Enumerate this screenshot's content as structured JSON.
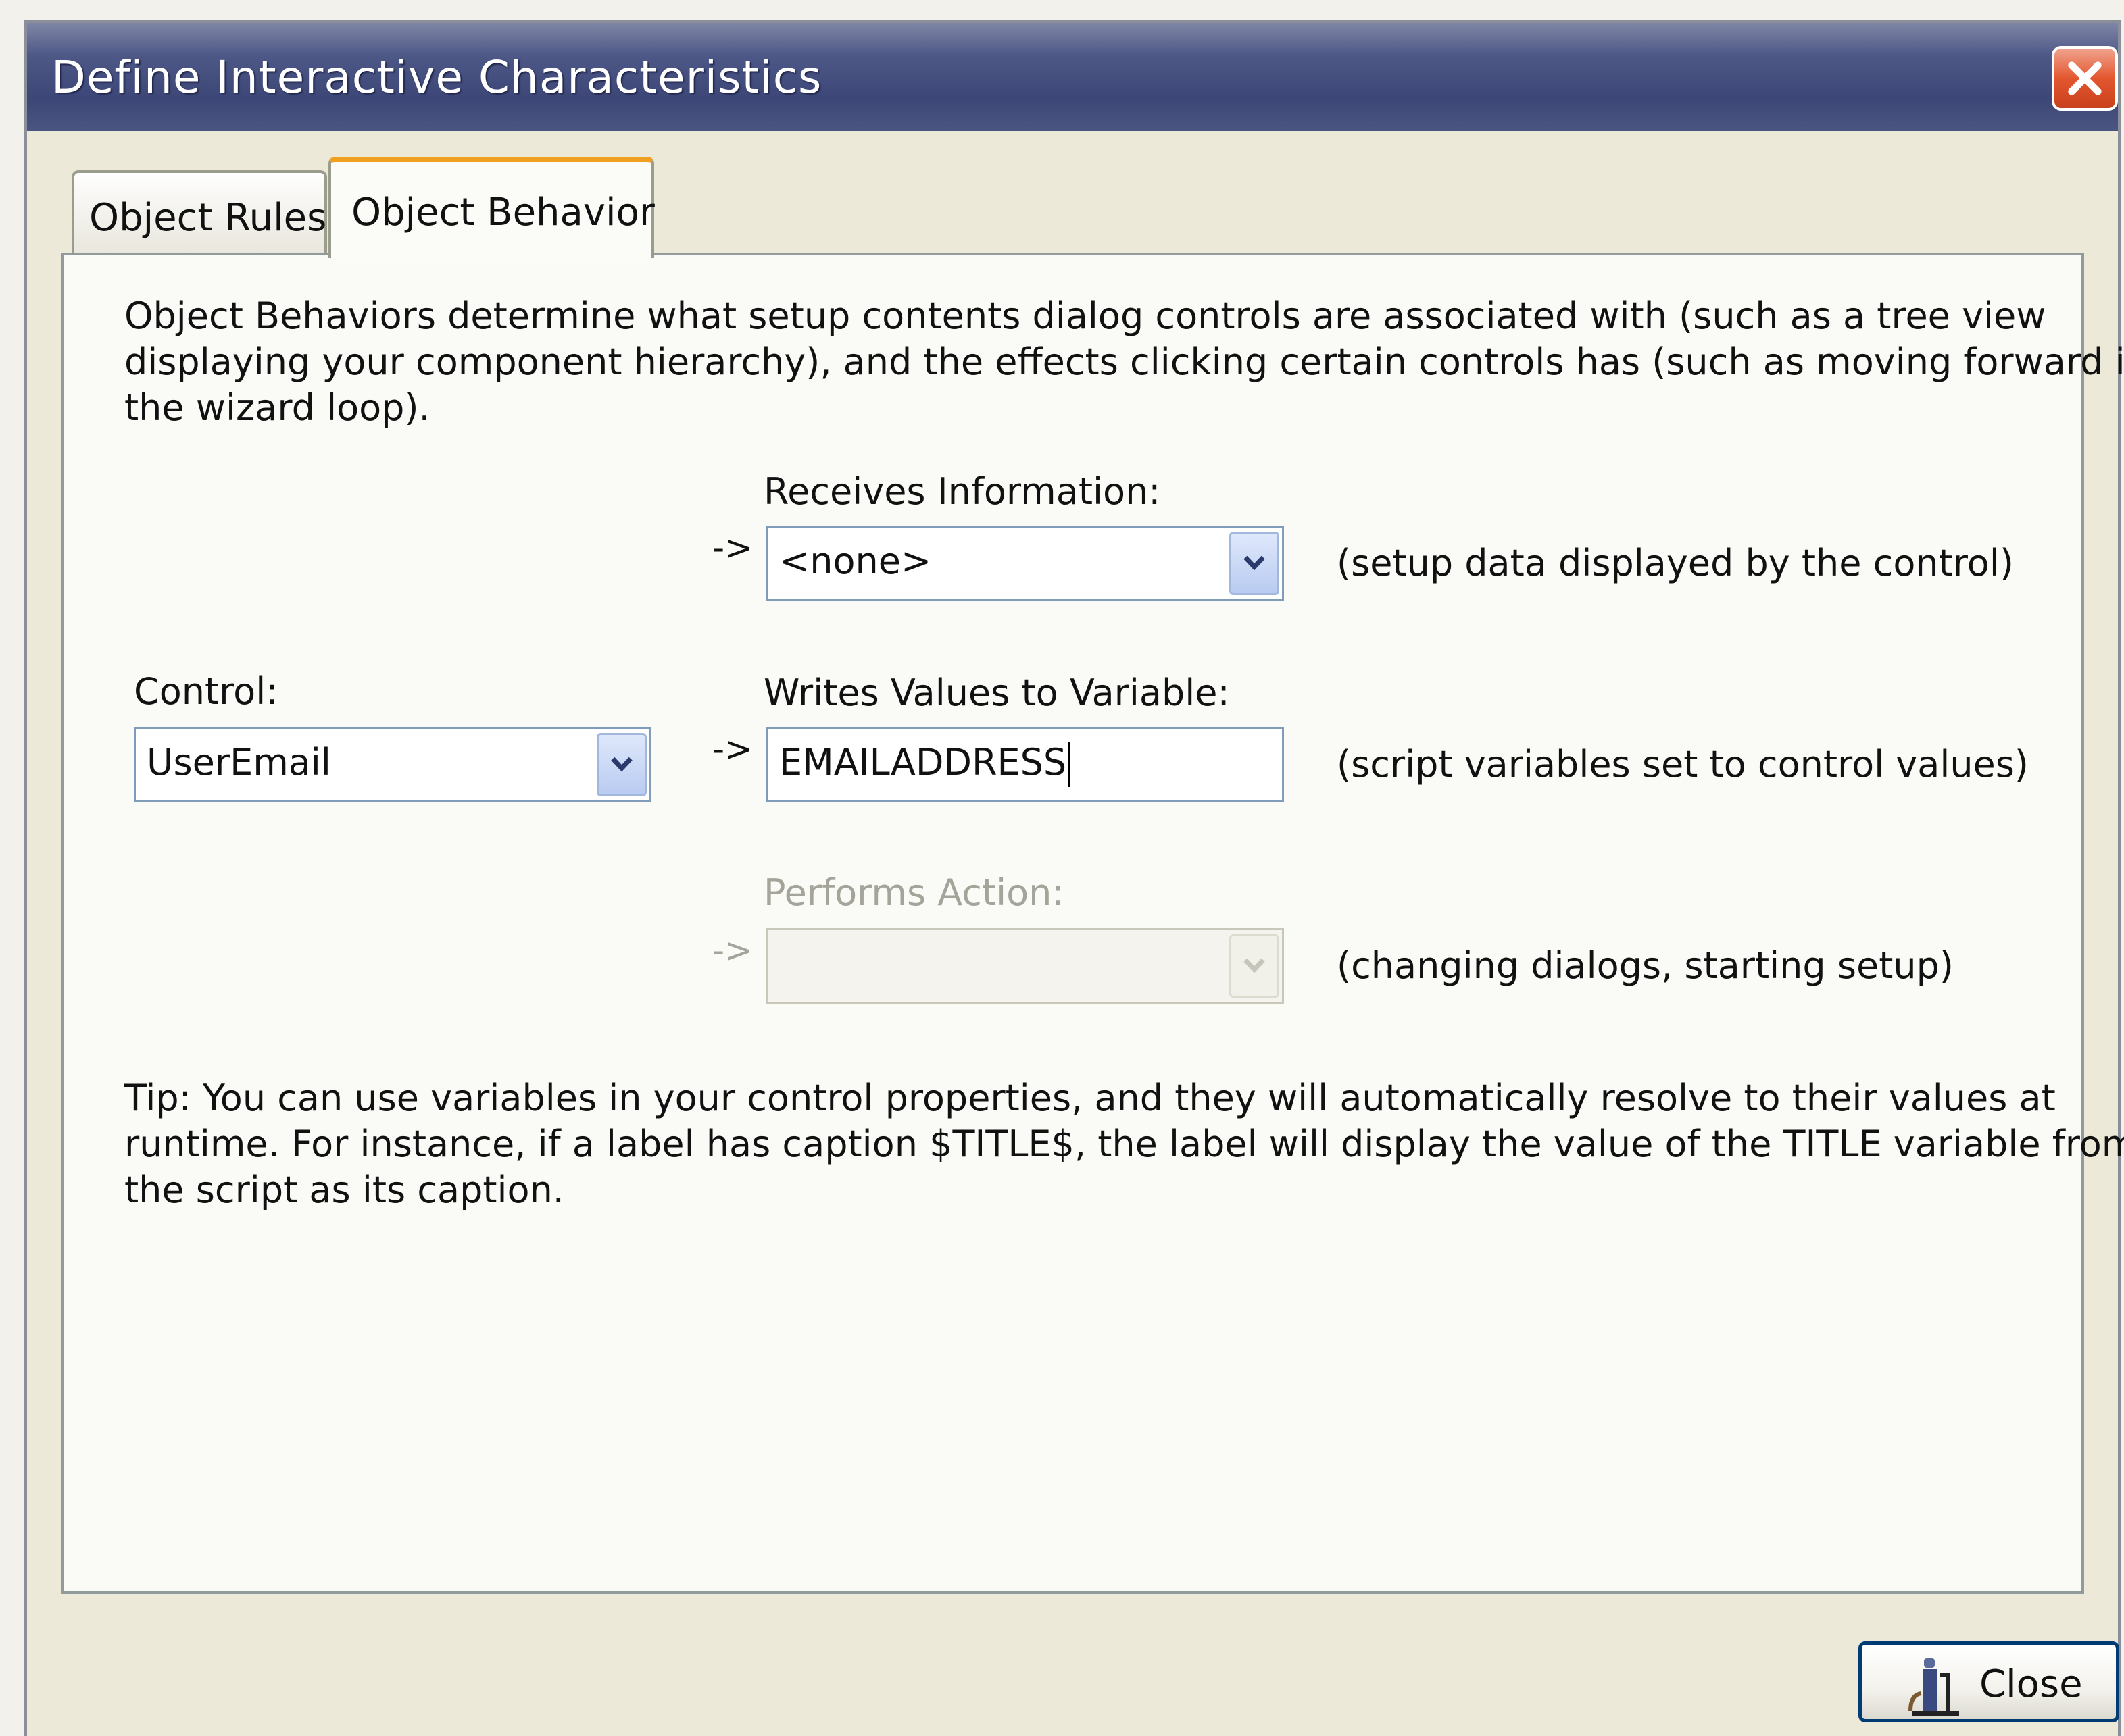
{
  "window": {
    "title": "Define Interactive Characteristics",
    "close_icon": "close-x-icon"
  },
  "tabs": [
    {
      "label": "Object Rules",
      "selected": false
    },
    {
      "label": "Object Behavior",
      "selected": true
    }
  ],
  "panel": {
    "description_lines": [
      "Object Behaviors determine what setup contents dialog controls are associated with (such as a tree view",
      "displaying your component hierarchy), and the effects clicking certain controls has (such as moving forward in",
      "the wizard loop)."
    ],
    "receives": {
      "label": "Receives Information:",
      "arrow": "->",
      "value": "<none>",
      "note": "(setup data displayed by the control)"
    },
    "control": {
      "label": "Control:",
      "value": "UserEmail"
    },
    "writes": {
      "label": "Writes Values to Variable:",
      "arrow": "->",
      "value": "EMAILADDRESS",
      "note": "(script variables set to control values)"
    },
    "performs": {
      "label": "Performs Action:",
      "arrow": "->",
      "value": "",
      "disabled": true,
      "note": "(changing dialogs, starting setup)"
    },
    "tip_lines": [
      "Tip: You can use variables in your control properties, and they will automatically resolve to their values at",
      "runtime. For instance, if a label has caption $TITLE$, the label will display the value of the TITLE variable from",
      "the script as its caption."
    ]
  },
  "footer": {
    "close_label": "Close",
    "close_icon": "door-exit-icon"
  },
  "colors": {
    "titlebar": "#3d4777",
    "close_x": "#e3572f",
    "active_tab_accent": "#f0a020",
    "field_border": "#7f9db9",
    "button_border": "#003c74"
  }
}
